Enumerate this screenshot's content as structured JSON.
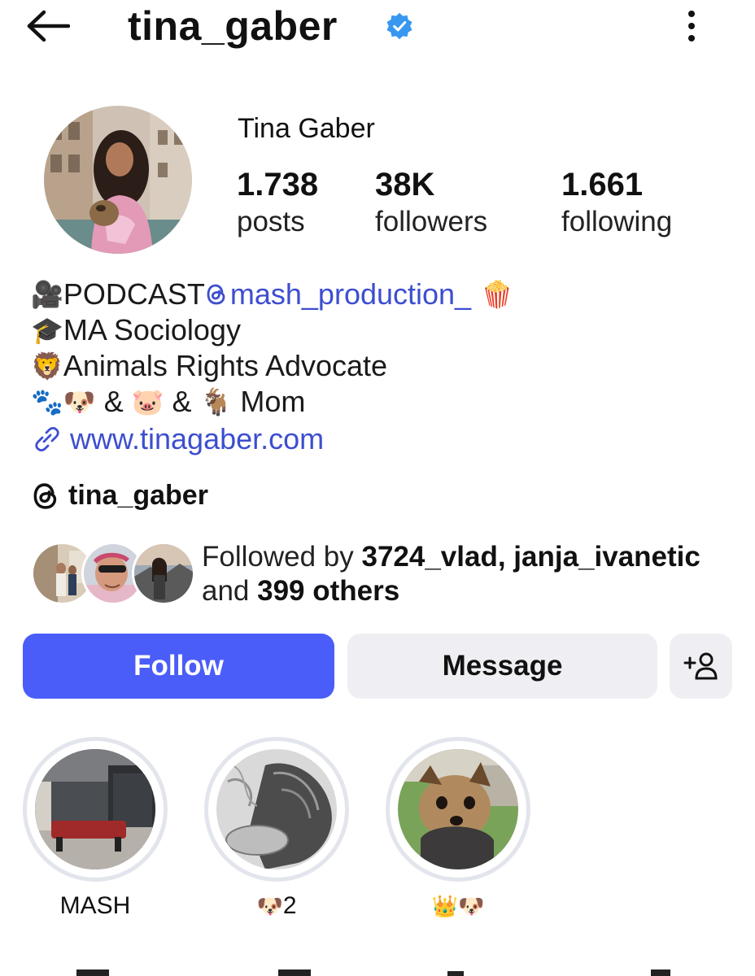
{
  "header": {
    "username": "tina_gaber",
    "verified": true,
    "icons": [
      "arrow-left-icon",
      "verified-badge-icon",
      "more-vertical-icon"
    ]
  },
  "profile": {
    "display_name": "Tina Gaber",
    "stats": {
      "posts": {
        "value": "1.738",
        "label": "posts"
      },
      "followers": {
        "value": "38K",
        "label": "followers"
      },
      "following": {
        "value": "1.661",
        "label": "following"
      }
    }
  },
  "bio": {
    "line1_prefix": "PODCAST ",
    "line1_mention": "mash_production_",
    "line2": "MA Sociology",
    "line3": "Animals Rights Advocate",
    "line4_amp": "&",
    "line4_mom": "Mom",
    "website": "www.tinagaber.com"
  },
  "threads": {
    "handle": "tina_gaber"
  },
  "followed_by": {
    "prefix": "Followed by ",
    "names": "3724_vlad, janja_ivanetic",
    "middle": "and ",
    "others": "399 others"
  },
  "actions": {
    "follow": "Follow",
    "message": "Message"
  },
  "highlights": [
    {
      "label": "MASH"
    },
    {
      "label": "2"
    },
    {
      "label": ""
    }
  ],
  "colors": {
    "accent": "#4a5df9",
    "link": "#3d4ecf",
    "verified": "#3897f0",
    "button_bg": "#efeff3"
  }
}
